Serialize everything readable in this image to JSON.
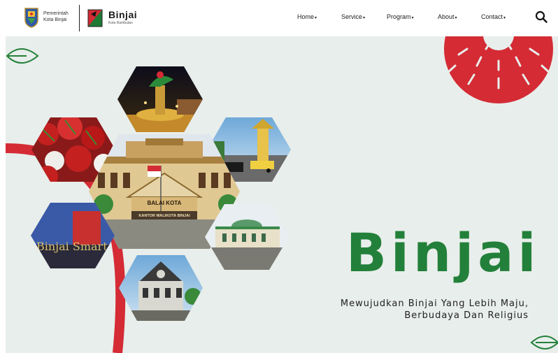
{
  "header": {
    "gov_line1": "Pemerintah",
    "gov_line2": "Kota Binjai",
    "brand": "Binjai",
    "brand_sub": "Kota Rambutan"
  },
  "nav": {
    "items": [
      {
        "label": "Home"
      },
      {
        "label": "Service"
      },
      {
        "label": "Program"
      },
      {
        "label": "About"
      },
      {
        "label": "Contact"
      }
    ],
    "caret": "▾"
  },
  "hero": {
    "title": "Binjai",
    "tagline_line1": "Mewujudkan Binjai Yang Lebih Maju,",
    "tagline_line2": "Berbudaya Dan Religius",
    "sign_text": "Binjai Smart",
    "balai_kota": "BALAI KOTA",
    "kantor": "KANTOR WALIKOTA BINJAI"
  },
  "colors": {
    "accent_green": "#23803a",
    "accent_red": "#d42b35",
    "hero_bg": "#e8eeeb"
  },
  "icons": {
    "search": "search-icon",
    "leaf": "leaf-icon",
    "sun": "sun-icon"
  }
}
